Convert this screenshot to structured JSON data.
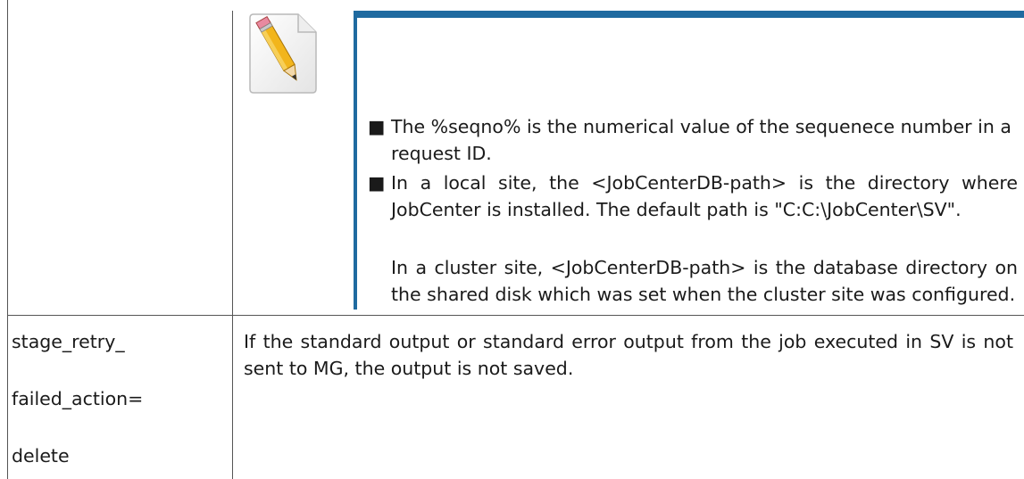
{
  "note": {
    "icon": "pencil-note-icon",
    "accent_color": "#1f6aa0",
    "bullet_symbol": "■",
    "bullets": [
      "The %seqno% is the numerical value of the sequenece number in a request ID.",
      "In a local site, the <JobCenterDB-path> is the directory where JobCenter is installed. The default path is \"C:C:\\JobCenter\\SV\"."
    ],
    "paragraph": "In a cluster site, <JobCenterDB-path> is the database directory on the shared disk which was set when the cluster site was configured."
  },
  "row": {
    "parameter_lines": [
      "stage_retry_",
      "failed_action=",
      "delete"
    ],
    "description": "If the standard output or standard error output from the job executed in SV is not sent to MG, the output is not saved."
  }
}
